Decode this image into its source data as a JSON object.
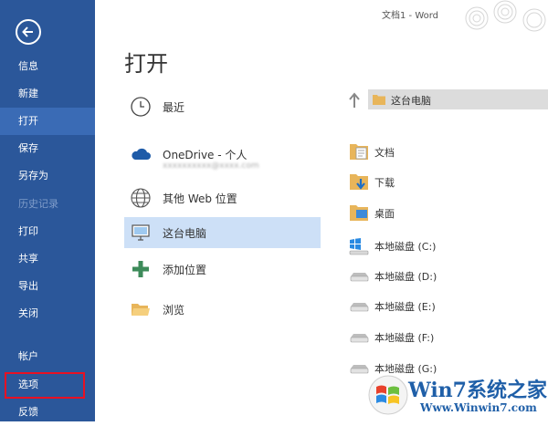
{
  "window": {
    "title": "文档1 - Word"
  },
  "sidebar": {
    "items": [
      {
        "label": "信息"
      },
      {
        "label": "新建"
      },
      {
        "label": "打开"
      },
      {
        "label": "保存"
      },
      {
        "label": "另存为"
      },
      {
        "label": "历史记录"
      },
      {
        "label": "打印"
      },
      {
        "label": "共享"
      },
      {
        "label": "导出"
      },
      {
        "label": "关闭"
      },
      {
        "label": "帐户"
      },
      {
        "label": "选项"
      },
      {
        "label": "反馈"
      }
    ],
    "active_item": "打开",
    "disabled_item": "历史记录",
    "highlighted_item": "选项"
  },
  "main": {
    "title": "打开",
    "locations": [
      {
        "label": "最近",
        "icon": "clock-icon"
      },
      {
        "label": "OneDrive - 个人",
        "sublabel": "xxxxxxxxxx@xxxx.com",
        "icon": "cloud-icon"
      },
      {
        "label": "其他 Web 位置",
        "icon": "globe-icon"
      },
      {
        "label": "这台电脑",
        "icon": "computer-icon"
      },
      {
        "label": "添加位置",
        "icon": "plus-icon"
      },
      {
        "label": "浏览",
        "icon": "folder-open-icon"
      }
    ],
    "selected_location": "这台电脑"
  },
  "right": {
    "path": "这台电脑",
    "items": [
      {
        "label": "文档",
        "icon": "documents-folder-icon"
      },
      {
        "label": "下载",
        "icon": "downloads-folder-icon"
      },
      {
        "label": "桌面",
        "icon": "desktop-folder-icon"
      },
      {
        "label": "本地磁盘 (C:)",
        "icon": "system-drive-icon"
      },
      {
        "label": "本地磁盘 (D:)",
        "icon": "drive-icon"
      },
      {
        "label": "本地磁盘 (E:)",
        "icon": "drive-icon"
      },
      {
        "label": "本地磁盘 (F:)",
        "icon": "drive-icon"
      },
      {
        "label": "本地磁盘 (G:)",
        "icon": "drive-icon"
      }
    ]
  },
  "watermark": {
    "text": "Win7系统之家",
    "url": "Www.Winwin7.com"
  },
  "colors": {
    "sidebar": "#2b579a",
    "selected": "#cde0f7",
    "highlight": "#e81123"
  }
}
